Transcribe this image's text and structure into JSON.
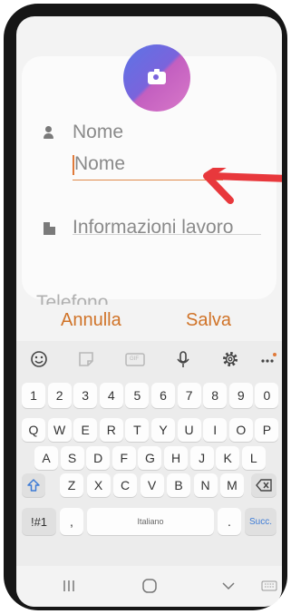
{
  "contact": {
    "name_label": "Nome",
    "name_placeholder": "Nome",
    "work_label": "Informazioni lavoro",
    "phone_label_partial": "Telefono"
  },
  "actions": {
    "cancel": "Annulla",
    "save": "Salva"
  },
  "keyboard": {
    "number_row": [
      "1",
      "2",
      "3",
      "4",
      "5",
      "6",
      "7",
      "8",
      "9",
      "0"
    ],
    "row1": [
      "Q",
      "W",
      "E",
      "R",
      "T",
      "Y",
      "U",
      "I",
      "O",
      "P"
    ],
    "row2": [
      "A",
      "S",
      "D",
      "F",
      "G",
      "H",
      "J",
      "K",
      "L"
    ],
    "row3": [
      "Z",
      "X",
      "C",
      "V",
      "B",
      "N",
      "M"
    ],
    "symbols_key": "!#1",
    "comma_key": ",",
    "space_label": "Italiano",
    "period_key": ".",
    "next_key": "Succ.",
    "gif_label": "GIF"
  },
  "colors": {
    "accent": "#d07328",
    "arrow": "#e8383c"
  }
}
